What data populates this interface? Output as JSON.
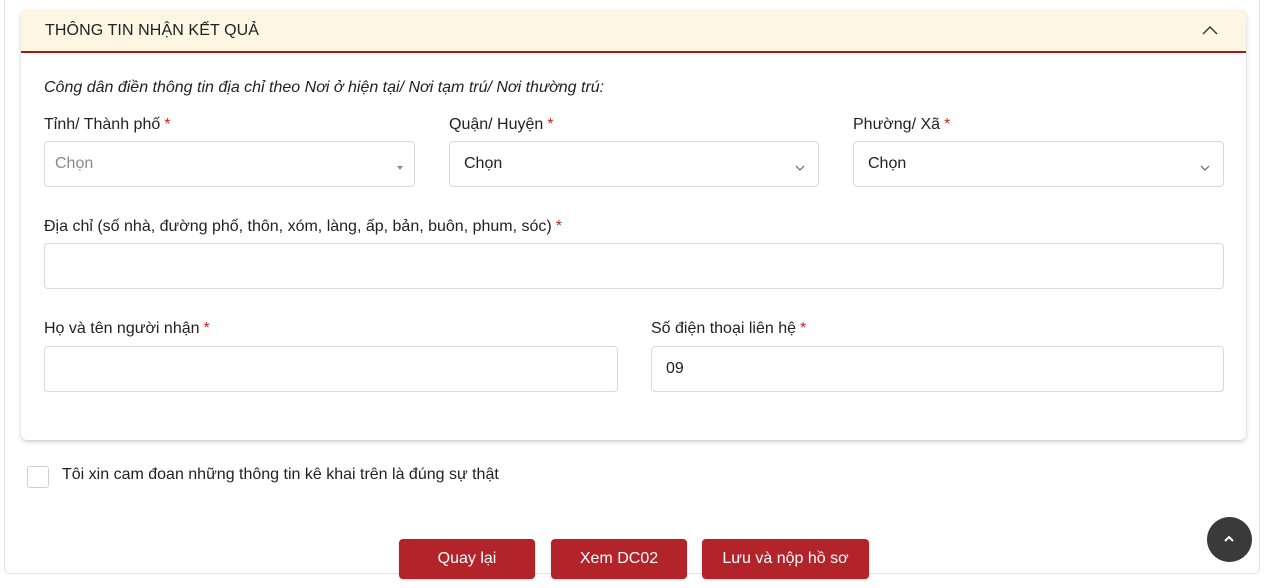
{
  "section": {
    "title": "THÔNG TIN NHẬN KẾT QUẢ",
    "collapse_icon": "chevron-up-icon"
  },
  "form": {
    "hint": "Công dân điền thông tin địa chỉ theo Nơi ở hiện tại/ Nơi tạm trú/ Nơi thường trú:",
    "required_mark": "*",
    "province": {
      "label": "Tỉnh/ Thành phố",
      "value": "Chọn"
    },
    "district": {
      "label": "Quận/ Huyện",
      "value": "Chọn"
    },
    "ward": {
      "label": "Phường/ Xã",
      "value": "Chọn"
    },
    "address": {
      "label": "Địa chỉ (số nhà, đường phố, thôn, xóm, làng, ấp, bản, buôn, phum, sóc)",
      "value": ""
    },
    "recipient_name": {
      "label": "Họ và tên người nhận",
      "value": ""
    },
    "phone": {
      "label": "Số điện thoại liên hệ",
      "value": "09"
    }
  },
  "agreement": {
    "label": "Tôi xin cam đoan những thông tin kê khai trên là đúng sự thật",
    "checked": false
  },
  "actions": {
    "back": "Quay lại",
    "preview": "Xem DC02",
    "submit": "Lưu và nộp hồ sơ"
  },
  "colors": {
    "primary": "#b3242a",
    "header_bg": "#fdf6e3",
    "required": "#c62828"
  }
}
